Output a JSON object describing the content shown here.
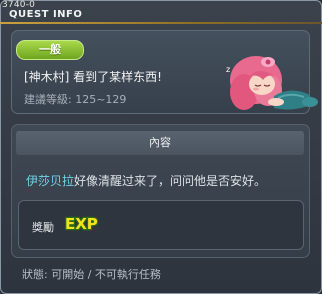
{
  "window": {
    "quest_id": "3740-0",
    "title": "QUEST INFO"
  },
  "summary": {
    "category": "一般",
    "quest_name": "[神木村] 看到了某样东西!",
    "level_range": "建議等級: 125~129",
    "npc_portrait": "sleeping-pink-haired-girl"
  },
  "content": {
    "header": "內容",
    "npc_name": "伊莎贝拉",
    "description": "好像清醒过来了，问问他是否安好。"
  },
  "reward": {
    "label": "獎勵",
    "icon": "exp-icon"
  },
  "status": {
    "text": "狀態: 可開始 / 不可執行任務"
  },
  "colors": {
    "accent_gold": "#c9a23e",
    "badge_green": "#8cc63a",
    "npc_link": "#6fd3e6"
  }
}
